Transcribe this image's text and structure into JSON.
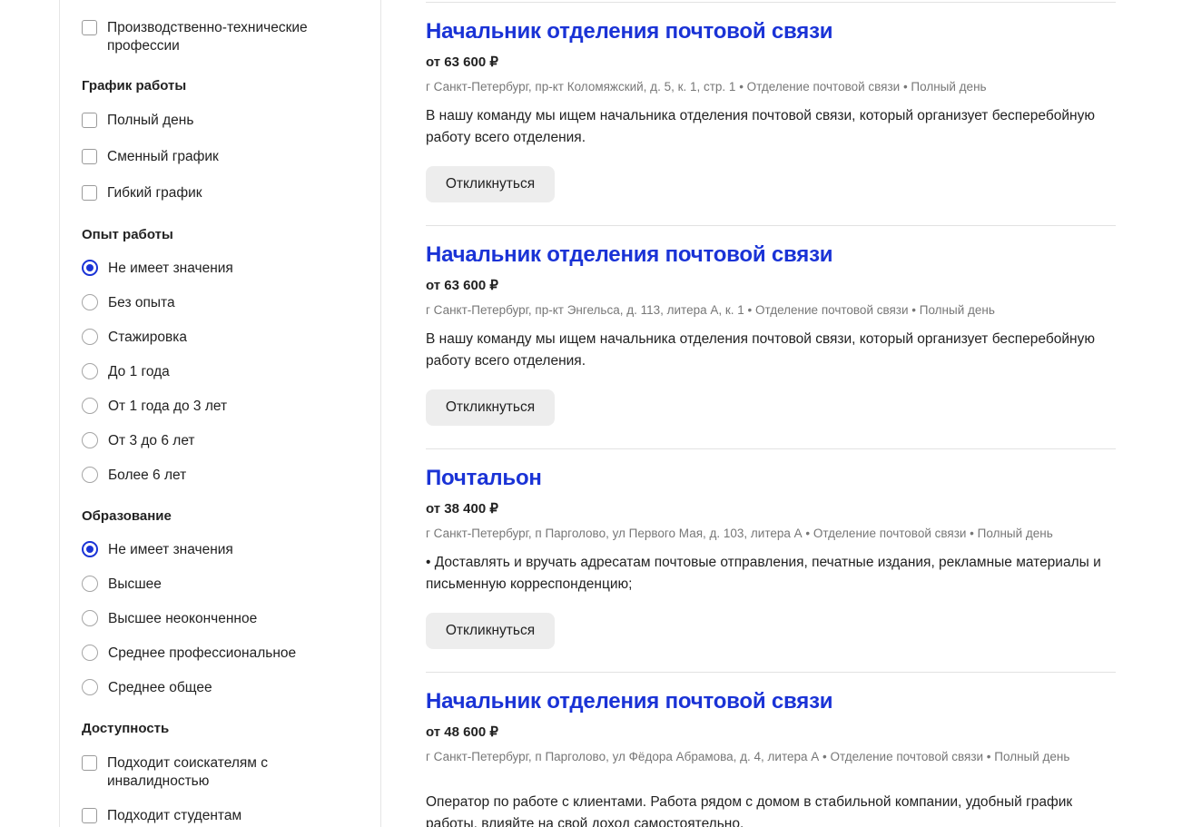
{
  "sidebar": {
    "top_option": "Производственно-технические профессии",
    "schedule": {
      "title": "График работы",
      "options": [
        "Полный день",
        "Сменный график",
        "Гибкий график"
      ]
    },
    "experience": {
      "title": "Опыт работы",
      "selected": 0,
      "options": [
        "Не имеет значения",
        "Без опыта",
        "Стажировка",
        "До 1 года",
        "От 1 года до 3 лет",
        "От 3 до 6 лет",
        "Более 6 лет"
      ]
    },
    "education": {
      "title": "Образование",
      "selected": 0,
      "options": [
        "Не имеет значения",
        "Высшее",
        "Высшее неоконченное",
        "Среднее профессиональное",
        "Среднее общее"
      ]
    },
    "accessibility": {
      "title": "Доступность",
      "options": [
        "Подходит соискателям с инвалидностью",
        "Подходит студентам"
      ]
    }
  },
  "jobs": [
    {
      "title": "Начальник отделения почтовой связи",
      "salary": "от 63 600 ₽",
      "meta": "г Санкт-Петербург, пр-кт Коломяжский, д. 5, к. 1, стр. 1 • Отделение почтовой связи • Полный день",
      "description": "В нашу команду мы ищем начальника отделения почтовой связи, который организует бесперебойную работу всего отделения.",
      "apply": "Откликнуться"
    },
    {
      "title": "Начальник отделения почтовой связи",
      "salary": "от 63 600 ₽",
      "meta": "г Санкт-Петербург, пр-кт Энгельса, д. 113, литера А, к. 1 • Отделение почтовой связи • Полный день",
      "description": "В нашу команду мы ищем начальника отделения почтовой связи, который организует бесперебойную работу всего отделения.",
      "apply": "Откликнуться"
    },
    {
      "title": "Почтальон",
      "salary": "от 38 400 ₽",
      "meta": "г Санкт-Петербург, п Парголово, ул Первого Мая, д. 103, литера А • Отделение почтовой связи • Полный день",
      "description": "• Доставлять и вручать адресатам почтовые отправления, печатные издания, рекламные материалы и письменную корреспонденцию;",
      "apply": "Откликнуться"
    },
    {
      "title": "Начальник отделения почтовой связи",
      "salary": "от 48 600 ₽",
      "meta": "г Санкт-Петербург, п Парголово, ул Фёдора Абрамова, д. 4, литера А • Отделение почтовой связи • Полный день",
      "description": "Оператор по работе с клиентами. Работа рядом с домом в стабильной компании, удобный график работы, влияйте на свой доход самостоятельно."
    }
  ]
}
